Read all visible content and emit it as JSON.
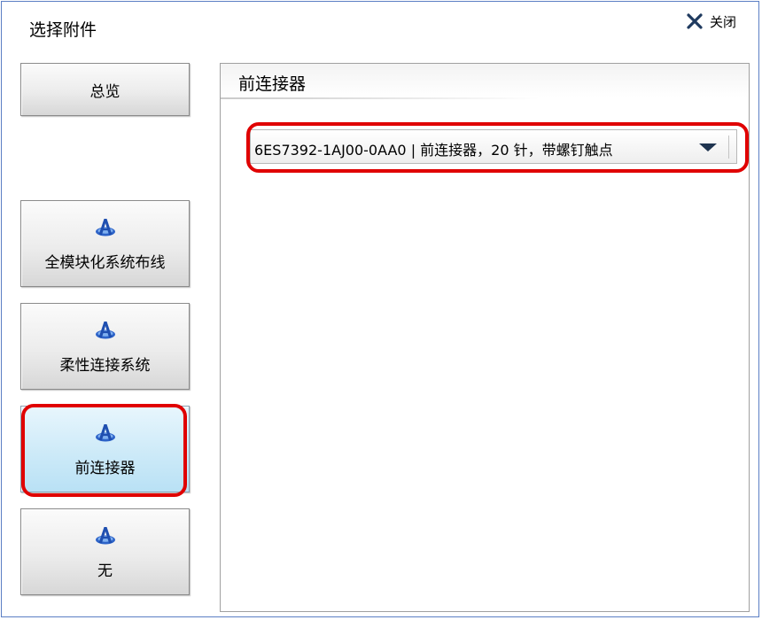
{
  "dialog": {
    "title": "选择附件",
    "close_label": "关闭"
  },
  "nav": {
    "overview": "总览",
    "items": [
      {
        "label": "全模块化系统布线",
        "icon": "blue-a-icon"
      },
      {
        "label": "柔性连接系统",
        "icon": "blue-a-icon"
      },
      {
        "label": "前连接器",
        "icon": "blue-a-icon",
        "selected": true
      },
      {
        "label": "无",
        "icon": "blue-a-icon"
      }
    ]
  },
  "panel": {
    "title": "前连接器",
    "selected_value": "6ES7392-1AJ00-0AA0 | 前连接器，20 针，带螺钉触点"
  },
  "colors": {
    "highlight": "#e00000",
    "selected_button": "#cdeaf8",
    "frame": "#5b7fc4"
  }
}
